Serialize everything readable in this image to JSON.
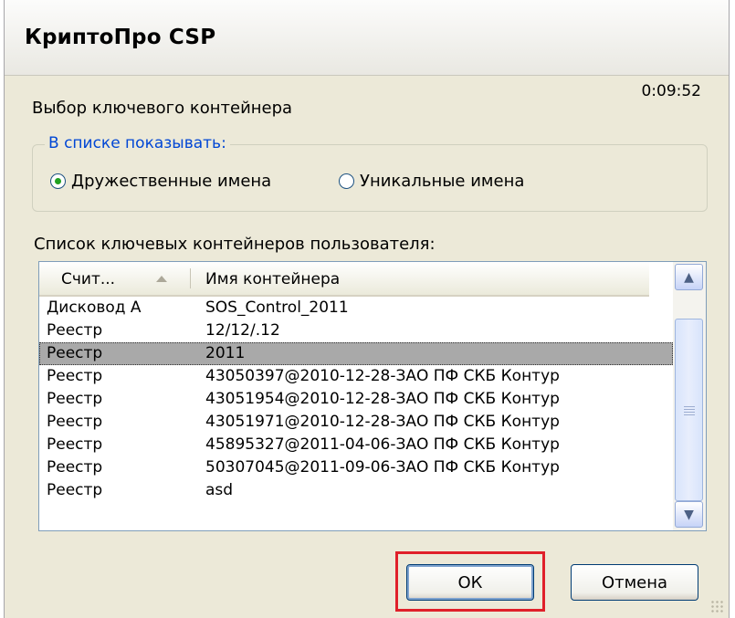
{
  "window": {
    "title": "КриптоПро CSP",
    "timer": "0:09:52"
  },
  "heading": "Выбор ключевого контейнера",
  "show_group": {
    "legend": "В списке показывать:",
    "options": [
      {
        "label": "Дружественные имена",
        "selected": true
      },
      {
        "label": "Уникальные имена",
        "selected": false
      }
    ]
  },
  "list": {
    "label": "Список ключевых контейнеров пользователя:",
    "columns": [
      "Счит...",
      "Имя контейнера"
    ],
    "rows": [
      {
        "reader": "Дисковод А",
        "name": "SOS_Control_2011"
      },
      {
        "reader": "Реестр",
        "name": "12/12/.12"
      },
      {
        "reader": "Реестр",
        "name": "2011"
      },
      {
        "reader": "Реестр",
        "name": "43050397@2010-12-28-ЗАО ПФ СКБ Контур"
      },
      {
        "reader": "Реестр",
        "name": "43051954@2010-12-28-ЗАО ПФ СКБ Контур"
      },
      {
        "reader": "Реестр",
        "name": "43051971@2010-12-28-ЗАО ПФ СКБ Контур"
      },
      {
        "reader": "Реестр",
        "name": "45895327@2011-04-06-ЗАО ПФ СКБ Контур"
      },
      {
        "reader": "Реестр",
        "name": "50307045@2011-09-06-ЗАО ПФ СКБ Контур"
      },
      {
        "reader": "Реестр",
        "name": "asd"
      }
    ],
    "selected_index": 2
  },
  "buttons": {
    "ok": "ОК",
    "cancel": "Отмена"
  },
  "colors": {
    "highlight": "#e0202a",
    "selection": "#a9a9a9",
    "dialog_bg": "#ece9d8"
  }
}
